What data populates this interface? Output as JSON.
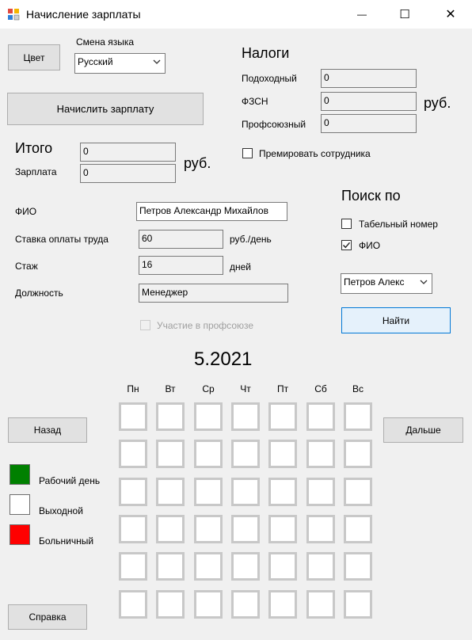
{
  "window": {
    "title": "Начисление зарплаты",
    "minimize_glyph": "—",
    "maximize_glyph": "☐",
    "close_glyph": "✕"
  },
  "left": {
    "color_button": "Цвет",
    "language_label": "Смена языка",
    "language_value": "Русский",
    "calc_button": "Начислить зарплату",
    "total_heading": "Итого",
    "total_value": "0",
    "salary_label": "Зарплата",
    "salary_value": "0",
    "salary_unit": "руб."
  },
  "taxes": {
    "heading": "Налоги",
    "income_label": "Подоходный",
    "income_value": "0",
    "fszn_label": "ФЗСН",
    "fszn_value": "0",
    "unit": "руб.",
    "union_label": "Профсоюзный",
    "union_value": "0",
    "bonus_label": "Премировать сотрудника",
    "bonus_checked": false
  },
  "employee": {
    "fio_label": "ФИО",
    "fio_value": "Петров Александр Михайлов",
    "rate_label": "Ставка оплаты труда",
    "rate_value": "60",
    "rate_unit": "руб./день",
    "exp_label": "Стаж",
    "exp_value": "16",
    "exp_unit": "дней",
    "position_label": "Должность",
    "position_value": "Менеджер",
    "union_member_label": "Участие в профсоюзе",
    "union_member_checked": false
  },
  "search": {
    "heading": "Поиск по",
    "by_tab_label": "Табельный номер",
    "by_tab_checked": false,
    "by_fio_label": "ФИО",
    "by_fio_checked": true,
    "combo_value": "Петров Алекс",
    "find_button": "Найти"
  },
  "calendar": {
    "month": "5.2021",
    "days": [
      "Пн",
      "Вт",
      "Ср",
      "Чт",
      "Пт",
      "Сб",
      "Вс"
    ],
    "rows": 6,
    "prev_button": "Назад",
    "next_button": "Дальше"
  },
  "legend": {
    "work_label": "Рабочий день",
    "work_color": "#008000",
    "off_label": "Выходной",
    "off_color": "#ffffff",
    "sick_label": "Больничный",
    "sick_color": "#ff0000"
  },
  "help_button": "Справка"
}
